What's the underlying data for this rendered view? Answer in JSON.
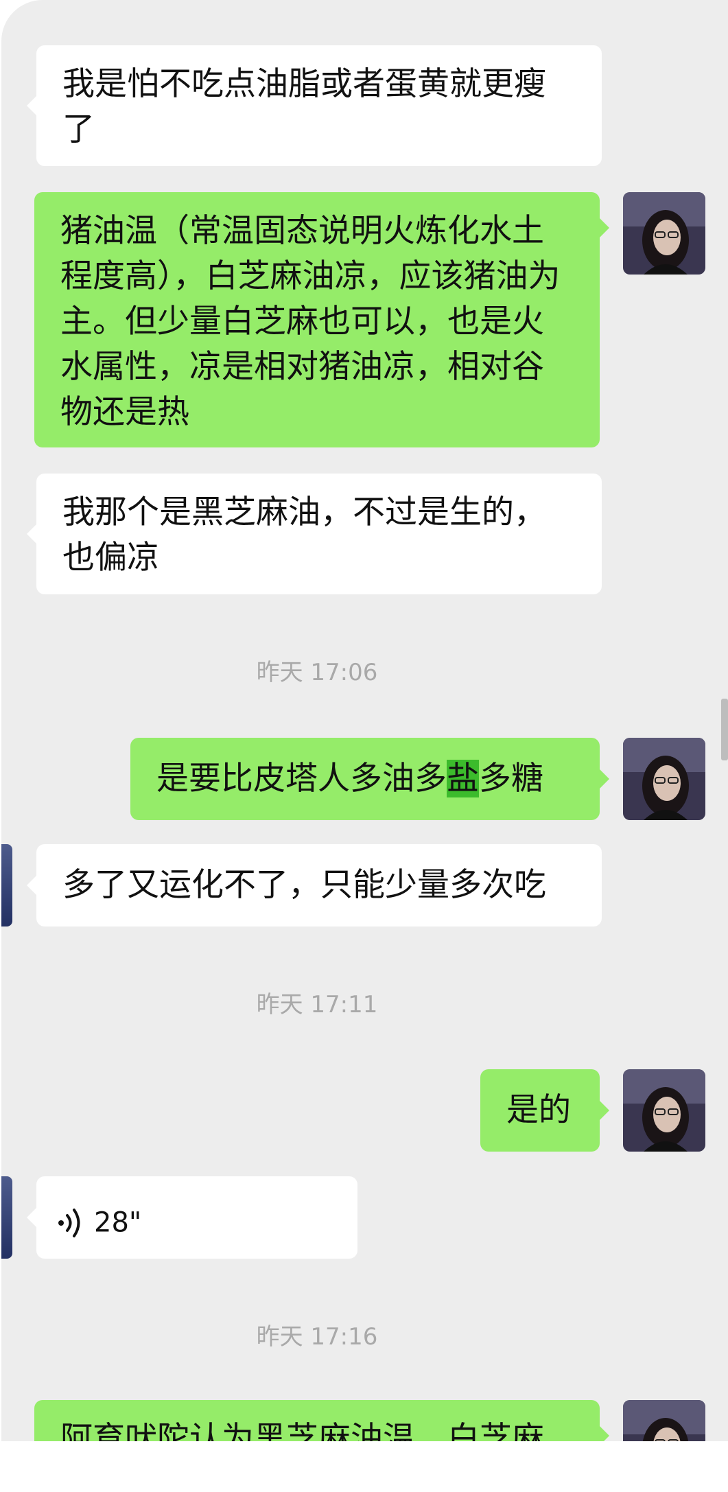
{
  "messages": [
    {
      "side": "left",
      "text": "我是怕不吃点油脂或者蛋黄就更瘦了"
    },
    {
      "side": "right",
      "text": "猪油温（常温固态说明火炼化水土程度高），白芝麻油凉，应该猪油为主。但少量白芝麻也可以，也是火水属性，凉是相对猪油凉，相对谷物还是热"
    },
    {
      "side": "left",
      "text": "我那个是黑芝麻油，不过是生的，也偏凉"
    },
    {
      "type": "time",
      "text": "昨天 17:06"
    },
    {
      "side": "right",
      "text_before": "是要比皮塔人多油多",
      "text_highlight": "盐",
      "text_after": "多糖"
    },
    {
      "side": "left",
      "text": "多了又运化不了，只能少量多次吃"
    },
    {
      "type": "time",
      "text": "昨天 17:11"
    },
    {
      "side": "right",
      "text": "是的"
    },
    {
      "side": "left",
      "type": "voice",
      "duration": "28\""
    },
    {
      "type": "time",
      "text": "昨天 17:16"
    },
    {
      "side": "right",
      "text": "阿育吠陀认为黑芝麻油温，白芝麻"
    }
  ],
  "colors": {
    "chat_background": "#ededed",
    "bubble_self": "#95ec69",
    "bubble_other": "#ffffff",
    "timestamp": "#a9a9a9",
    "highlight": "#3cbb2c"
  },
  "icons": {
    "voice": "voice-wave-icon",
    "avatar": "avatar-photo"
  }
}
